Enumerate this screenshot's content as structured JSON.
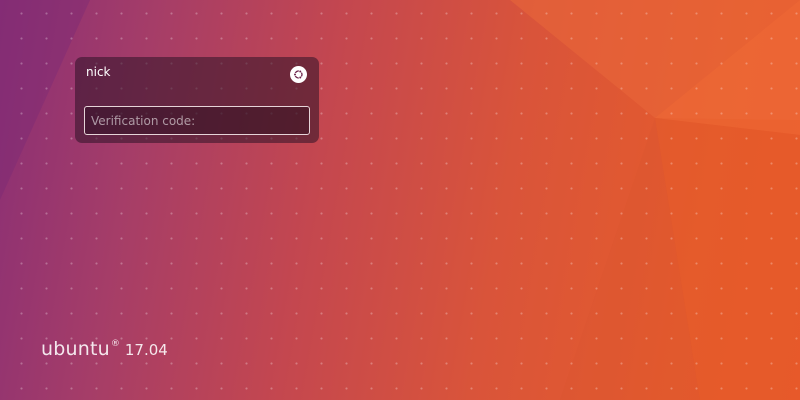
{
  "login": {
    "username": "nick",
    "session_icon": "ubuntu-logo-icon",
    "input_placeholder": "Verification code:",
    "input_value": ""
  },
  "branding": {
    "name": "ubuntu",
    "mark": "®",
    "version": "17.04"
  },
  "colors": {
    "wallpaper_purple": "#8a2f75",
    "wallpaper_orange": "#e55b2c",
    "panel_background": "#2d1226"
  }
}
